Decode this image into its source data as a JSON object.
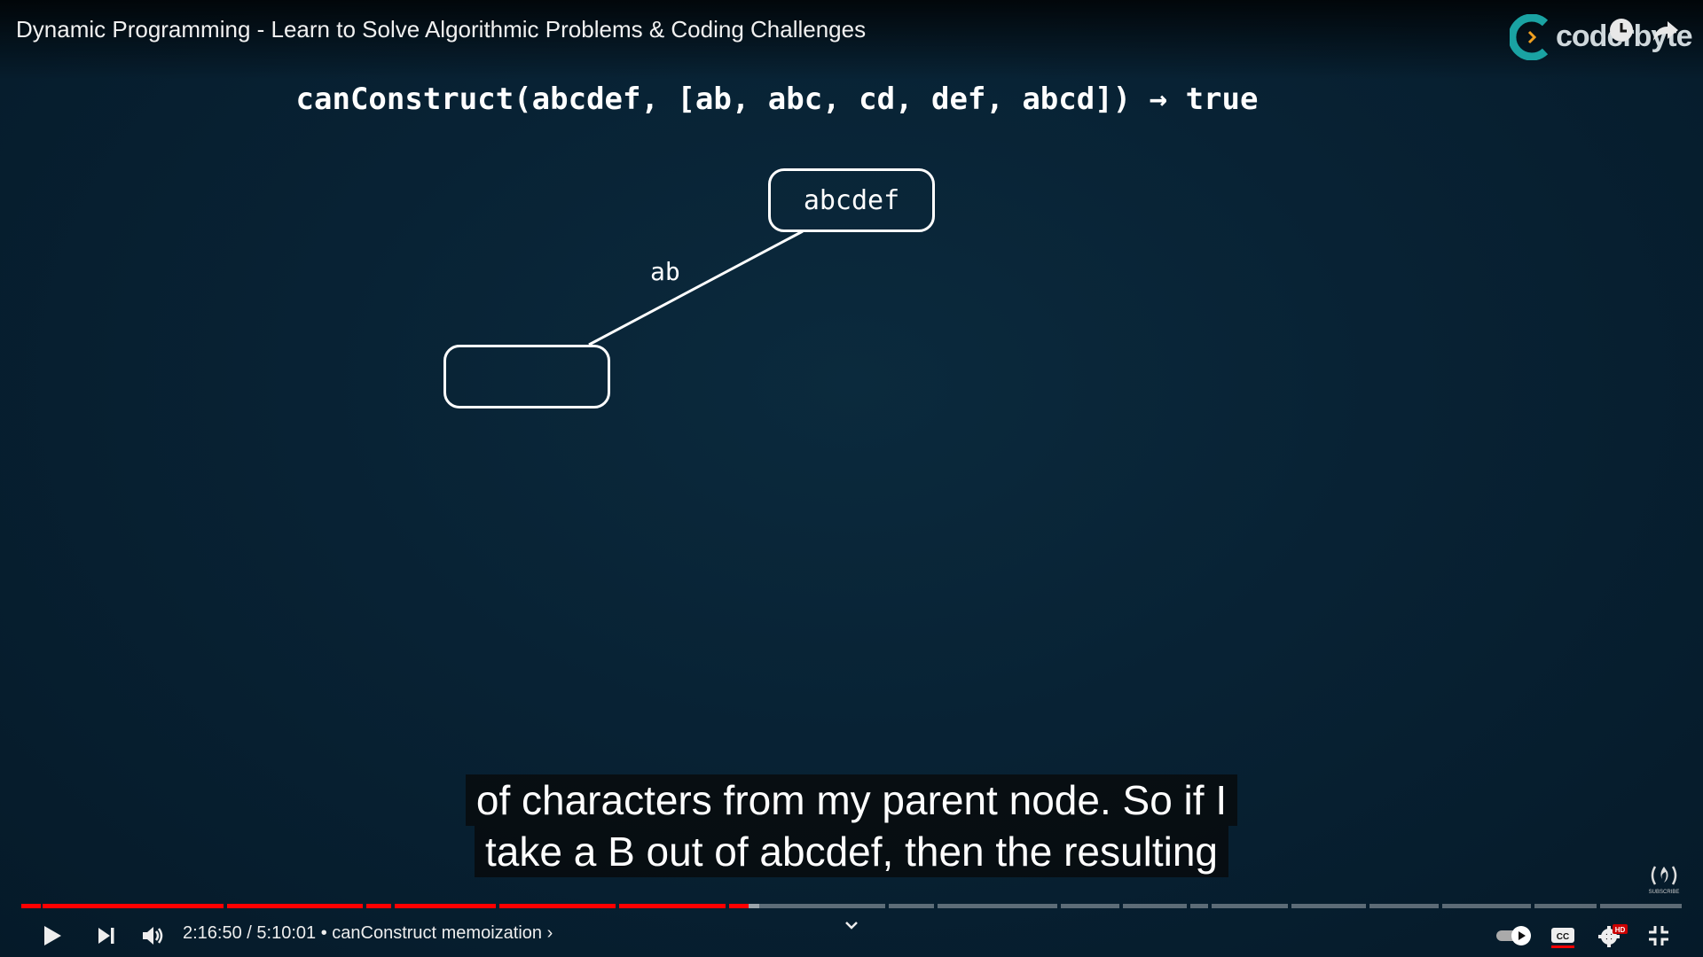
{
  "video": {
    "title": "Dynamic Programming - Learn to Solve Algorithmic Problems & Coding Challenges",
    "brand": "coderbyte"
  },
  "slide": {
    "headline": "canConstruct(abcdef, [ab, abc, cd, def, abcd]) → true",
    "root_node": "abcdef",
    "child_node": "",
    "edge_label": "ab"
  },
  "captions": {
    "line1": "of characters from my parent node. So if I",
    "line2": "take a B out of abcdef, then the resulting"
  },
  "player": {
    "current_time": "2:16:50",
    "duration": "5:10:01",
    "time_display": "2:16:50 / 5:10:01",
    "chapter": "• canConstruct memoization ›",
    "progress_fraction": 0.44,
    "subscribe_label": "SUBSCRIBE",
    "quality_badge": "HD"
  },
  "icons": {
    "play": "play-icon",
    "next": "next-icon",
    "volume": "volume-icon",
    "autoplay": "autoplay-toggle",
    "captions": "cc-icon",
    "settings": "gear-icon",
    "exit_fullscreen": "exit-fullscreen-icon",
    "watch_later": "clock-icon",
    "share": "share-icon"
  },
  "colors": {
    "played": "#ff0000",
    "background": "#082234",
    "brand_teal": "#1aa3a3"
  }
}
